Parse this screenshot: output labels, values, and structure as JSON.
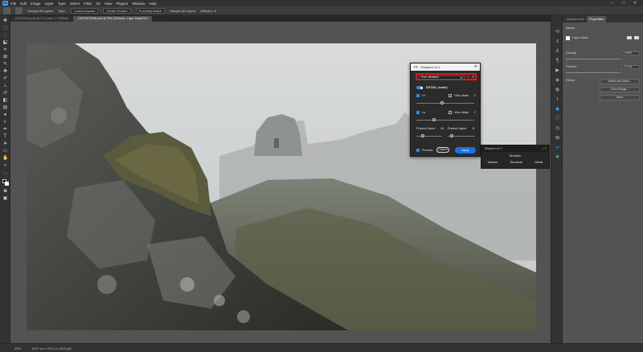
{
  "menu": {
    "logo": "Ps",
    "items": [
      "File",
      "Edit",
      "Image",
      "Layer",
      "Type",
      "Select",
      "Filter",
      "3D",
      "View",
      "Plugins",
      "Window",
      "Help"
    ],
    "window_controls": [
      "–",
      "□",
      "✕"
    ]
  },
  "options": {
    "items": [
      "Sample All Layers",
      "Type:",
      "Content-Aware",
      "Create Texture",
      "Proximity Match",
      "Sample All Layers",
      "Diffusion: 5"
    ]
  },
  "tabs": [
    {
      "label": "_DSC0000.ps @ 66.7% (Layer 1, RGB/8#)",
      "active": false
    },
    {
      "label": "_DSC2573-Edit.psd @ 25% (Sharpen, Layer Mask/16) *",
      "active": true
    }
  ],
  "status": {
    "zoom": "25%",
    "doc_info": "6047 px x 4031 px (300 ppi)"
  },
  "right_panel": {
    "tabs": [
      "Adjustments",
      "Properties"
    ],
    "active_tab": "Properties",
    "section_masks": "Masks",
    "layer_mask_label": "Layer Mask",
    "density_label": "Density:",
    "density_value": "100%",
    "feather_label": "Feather:",
    "feather_value": "0.0 px",
    "refine_label": "Refine:",
    "select_and_mask": "Select and Mask...",
    "color_range": "Color Range...",
    "invert": "Invert"
  },
  "dialog": {
    "title": "PF - Sharpen v1.1",
    "close": "✕",
    "preset": "Fine detailed",
    "preset_minus": "–",
    "preset_plus": "+",
    "detail_label": "DETAIL (small)",
    "hi_label": "Hi",
    "lo_label": "Lo",
    "view_mask_1": "View Mask",
    "view_mask_2": "View Mask",
    "protect_darks_label": "Protect Darks",
    "protect_darks_value": "24",
    "protect_lights_label": "Protect Lights",
    "protect_lights_value": "8",
    "preview_label": "Preview",
    "cancel": "Cancel",
    "apply": "Apply",
    "hi_slider": 0.45,
    "lo_slider": 0.3,
    "protect_darks_slider": 0.25,
    "protect_lights_slider": 0.15
  },
  "mini_panel": {
    "header": "Sharpen v1.1",
    "controls": "»  ≡",
    "title": "Sharpen",
    "tabs": [
      "Volume",
      "Structure",
      "Detail"
    ]
  }
}
